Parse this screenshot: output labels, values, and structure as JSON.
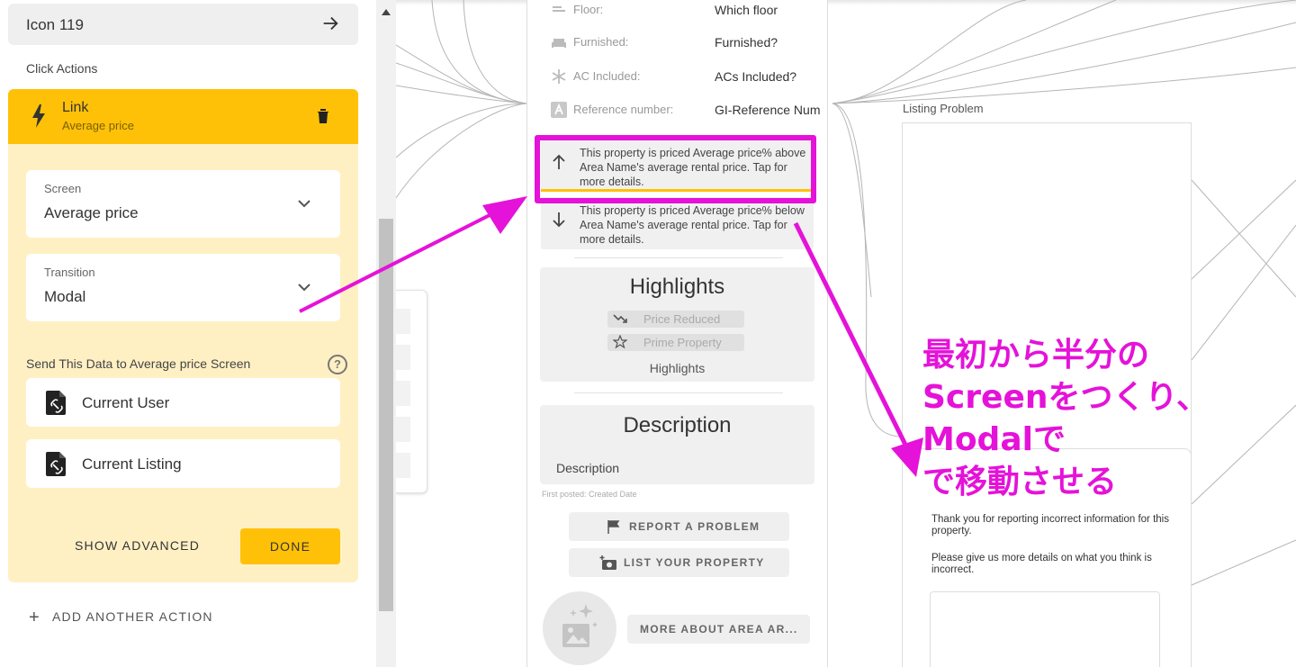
{
  "left_panel": {
    "icon_card_label": "Icon 119",
    "click_actions_label": "Click Actions",
    "action": {
      "title": "Link",
      "subtitle": "Average price"
    },
    "screen_field": {
      "label": "Screen",
      "value": "Average price"
    },
    "transition_field": {
      "label": "Transition",
      "value": "Modal"
    },
    "send_data_label": "Send This Data to Average price Screen",
    "help_glyph": "?",
    "data_items": [
      {
        "label": "Current User"
      },
      {
        "label": "Current Listing"
      }
    ],
    "show_advanced_label": "SHOW ADVANCED",
    "done_label": "DONE",
    "add_action_label": "ADD ANOTHER ACTION",
    "add_action_glyph": "+"
  },
  "phone": {
    "properties": [
      {
        "icon": "floor-icon",
        "label": "Floor:",
        "value": "Which floor"
      },
      {
        "icon": "sofa-icon",
        "label": "Furnished:",
        "value": "Furnished?"
      },
      {
        "icon": "snowflake-icon",
        "label": "AC Included:",
        "value": "ACs Included?"
      },
      {
        "icon": "letter-a-icon",
        "label": "Reference number:",
        "value": "GI-Reference Num"
      }
    ],
    "price_above_text": "This property is priced Average price% above Area Name's average rental price. Tap for more details.",
    "price_below_text": "This property is priced Average price% below Area Name's average rental price. Tap for more details.",
    "highlights": {
      "heading": "Highlights",
      "chips": [
        "Price Reduced",
        "Prime Property"
      ],
      "footer": "Highlights"
    },
    "description": {
      "heading": "Description",
      "text": "Description",
      "first_posted": "First posted: Created Date"
    },
    "report_button": "REPORT A PROBLEM",
    "list_button": "LIST YOUR PROPERTY",
    "more_button": "MORE ABOUT AREA AR..."
  },
  "listing_problem": {
    "frame_label": "Listing Problem",
    "modal_text_1": "Thank you for reporting incorrect information for this property.",
    "modal_text_2": "Please give us more details on what you think is incorrect."
  },
  "annotation": {
    "lines": [
      "最初から半分の",
      "Screenをつくり、",
      "Modalで",
      "で移動させる"
    ],
    "color": "#e512d9"
  },
  "colors": {
    "accent_yellow": "#ffc107",
    "panel_cream": "#fff0c4",
    "annotation_magenta": "#e512d9"
  }
}
